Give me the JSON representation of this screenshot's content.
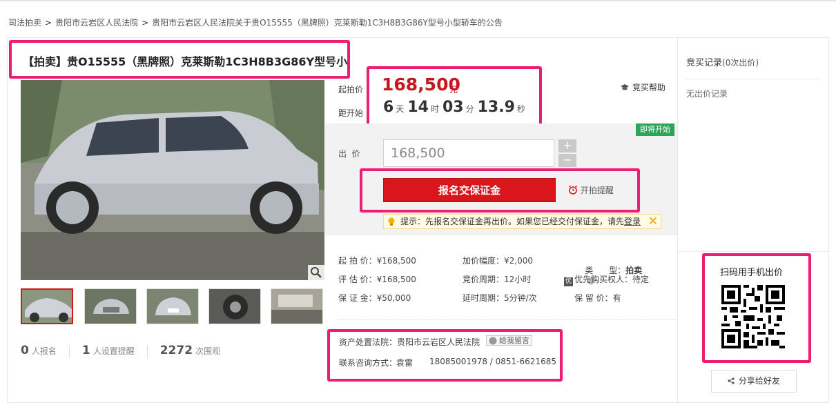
{
  "breadcrumb": [
    "司法拍卖",
    "贵阳市云岩区人民法院",
    "贵阳市云岩区人民法院关于贵O15555（黑牌照）克莱斯勒1C3H8B3G86Y型号小型轿车的公告"
  ],
  "breadcrumb_sep": ">",
  "title": "【拍卖】贵O15555（黑牌照）克莱斯勒1C3H8B3G86Y型号小",
  "price": {
    "label": "起拍价",
    "value": "168,500",
    "unit": "元"
  },
  "countdown": {
    "label": "距开始",
    "days": "6",
    "days_unit": "天",
    "hours": "14",
    "hours_unit": "时",
    "minutes": "03",
    "minutes_unit": "分",
    "seconds": "13.9",
    "seconds_unit": "秒"
  },
  "help_label": "竞买帮助",
  "status_badge": "即将开始",
  "bid": {
    "label": "出  价",
    "value": "168,500",
    "plus": "+",
    "minus": "−"
  },
  "deposit_button": "报名交保证金",
  "remind_label": "开拍提醒",
  "tip": {
    "text": "提示：先报名交保证金再出价。如果您已经交付保证金，请先",
    "link": "登录"
  },
  "details": {
    "start_price": "起 拍 价：¥168,500",
    "appraised": "评 估 价：¥168,500",
    "deposit": "保 证 金：¥50,000",
    "increment": "加价幅度：¥2,000",
    "cycle": "竞价周期：12小时",
    "extend": "延时周期：5分钟/次",
    "type_label": "类      型：",
    "type_value": "拍卖",
    "priority_badge": "优",
    "priority": "优先购买权人：待定",
    "reserve": "保 留 价：有"
  },
  "court": {
    "label": "资产处置法院：",
    "name": "贵阳市云岩区人民法院",
    "message_button": "给我留言",
    "contact_label": "联系咨询方式：",
    "contact_name": "袁雷",
    "phones": "18085001978 / 0851-6621685"
  },
  "stats": [
    {
      "num": "0",
      "label": "人报名"
    },
    {
      "num": "1",
      "label": "人设置提醒"
    },
    {
      "num": "2272",
      "label": "次围观"
    }
  ],
  "records": {
    "title": "竞买记录",
    "count": "(0次出价)",
    "empty": "无出价记录"
  },
  "qr_title": "扫码用手机出价",
  "share_label": "分享给好友",
  "icons": {
    "zoom": "magnifier-icon",
    "help": "graduation-cap-icon",
    "alarm": "alarm-clock-icon",
    "bulb": "lightbulb-icon",
    "share": "share-icon",
    "question": "question-circle-icon"
  },
  "colors": {
    "accent": "#d9161c",
    "highlight": "#ec1e73",
    "status": "#2aa55a"
  }
}
